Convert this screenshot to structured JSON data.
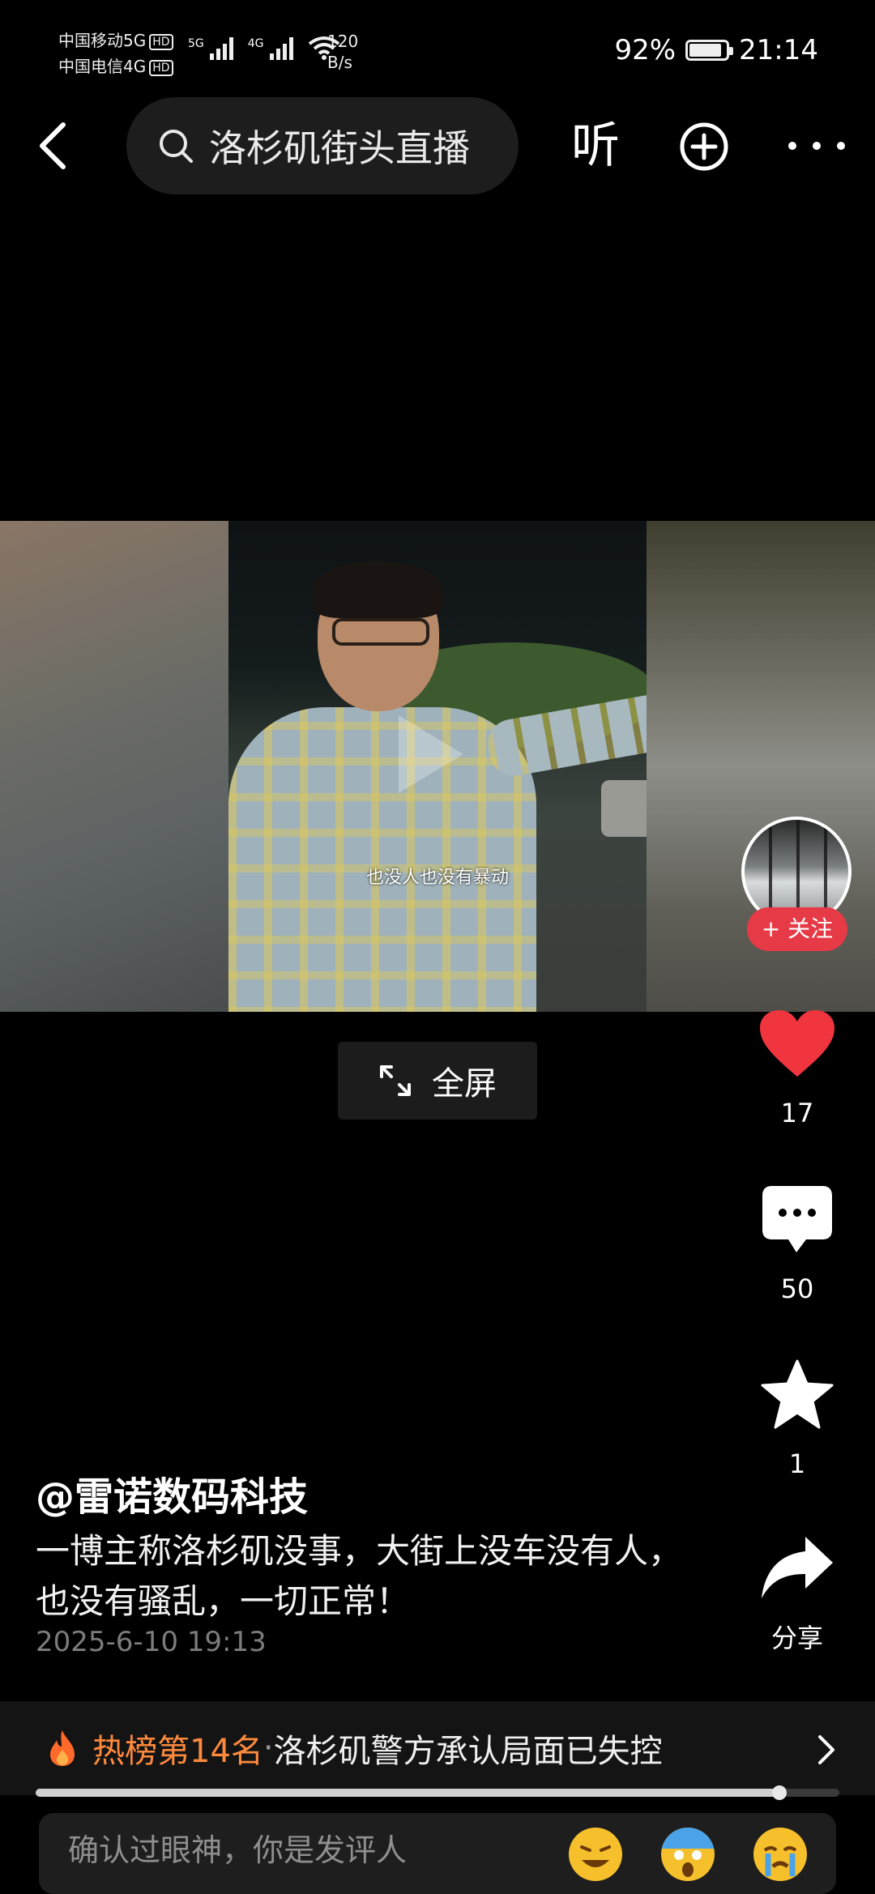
{
  "status_bar": {
    "carrier1": "中国移动5G",
    "carrier2": "中国电信4G",
    "hd": "HD",
    "net_type1": "5G",
    "net_type2": "4G",
    "net_speed_value": "120",
    "net_speed_unit": "B/s",
    "battery": "92%",
    "battery_level": 0.92,
    "time": "21:14"
  },
  "top_bar": {
    "search_text": "洛杉矶街头直播",
    "listen_label": "听",
    "icons": [
      "back-chevron-icon",
      "search-icon",
      "plus-circle-icon",
      "more-dots-icon"
    ]
  },
  "video": {
    "subtitle": "也没人也没有暴动",
    "follow_label": "+ 关注",
    "fullscreen_label": "全屏"
  },
  "actions": {
    "likes": "17",
    "comments": "50",
    "favorites": "1",
    "share_label": "分享",
    "like_color": "#f0353f"
  },
  "post": {
    "author": "@雷诺数码科技",
    "description": "一博主称洛杉矶没事，大街上没车没有人，也没有骚乱，一切正常！",
    "date": "2025-6-10 19:13"
  },
  "hot": {
    "rank": "热榜第14名",
    "separator": " · ",
    "title": "洛杉矶警方承认局面已失控",
    "rank_color": "#ff8a3d"
  },
  "playback": {
    "progress": 0.925
  },
  "comment_bar": {
    "placeholder": "确认过眼神，你是发评人"
  }
}
